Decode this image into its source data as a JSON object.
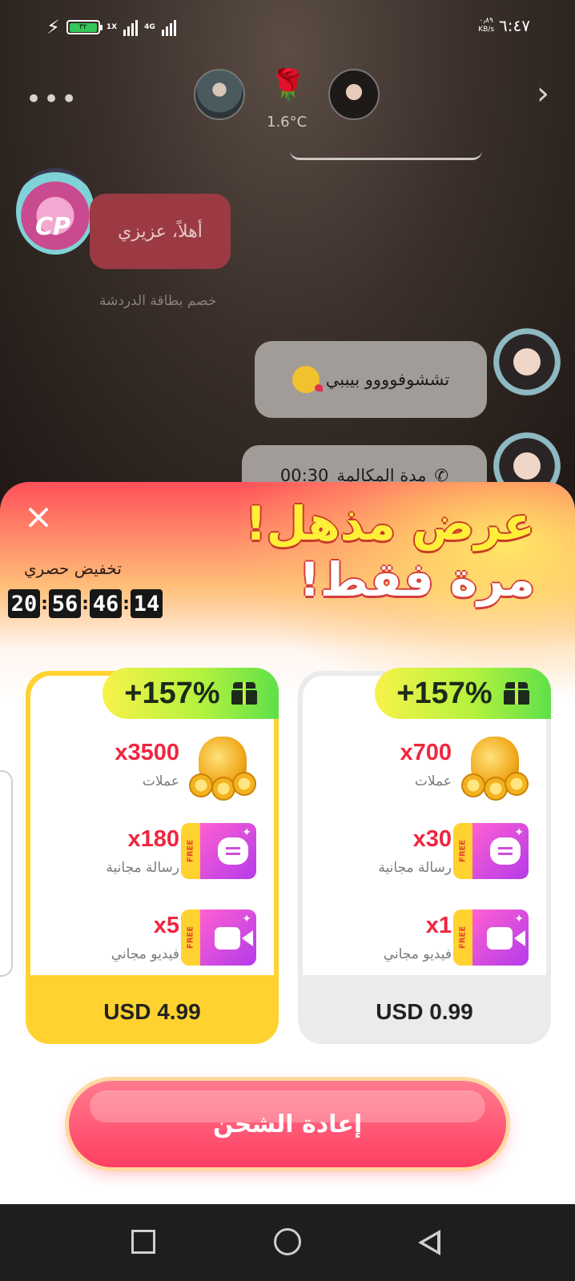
{
  "status_bar": {
    "battery_level": "٣٢",
    "network_tags": [
      "1X",
      "4G"
    ],
    "speed_value": "٠٫٨٩",
    "speed_unit": "KB/s",
    "time": "٦:٤٧"
  },
  "chat": {
    "temperature": "1.6°C",
    "received_message": "أهلاً، عزيزي",
    "card_note": "خصم بطاقة الدردشة",
    "sent_message": "تششوفوووو بيببي",
    "call_label": "مدة المكالمة",
    "call_duration": "00:30",
    "badge_text": "CP"
  },
  "offer": {
    "headline_line1": "عرض مذهل!",
    "headline_line2": "مرة فقط!",
    "discount_label": "تخفيض حصري",
    "countdown": [
      "20",
      "56",
      "46",
      "14"
    ],
    "packages": [
      {
        "bonus": "+157%",
        "coins_value": "x3500",
        "coins_label": "عملات",
        "messages_value": "x180",
        "messages_label": "رسالة مجانية",
        "video_value": "x5",
        "video_label": "فيديو مجاني",
        "price": "USD 4.99",
        "selected": true
      },
      {
        "bonus": "+157%",
        "coins_value": "x700",
        "coins_label": "عملات",
        "messages_value": "x30",
        "messages_label": "رسالة مجانية",
        "video_value": "x1",
        "video_label": "فيديو مجاني",
        "price": "USD 0.99",
        "selected": false
      }
    ],
    "free_tag": "FREE",
    "recharge_label": "إعادة الشحن"
  },
  "colors": {
    "accent_red": "#f0263f",
    "selected_card": "#ffd230",
    "button": "#ff3e63"
  }
}
